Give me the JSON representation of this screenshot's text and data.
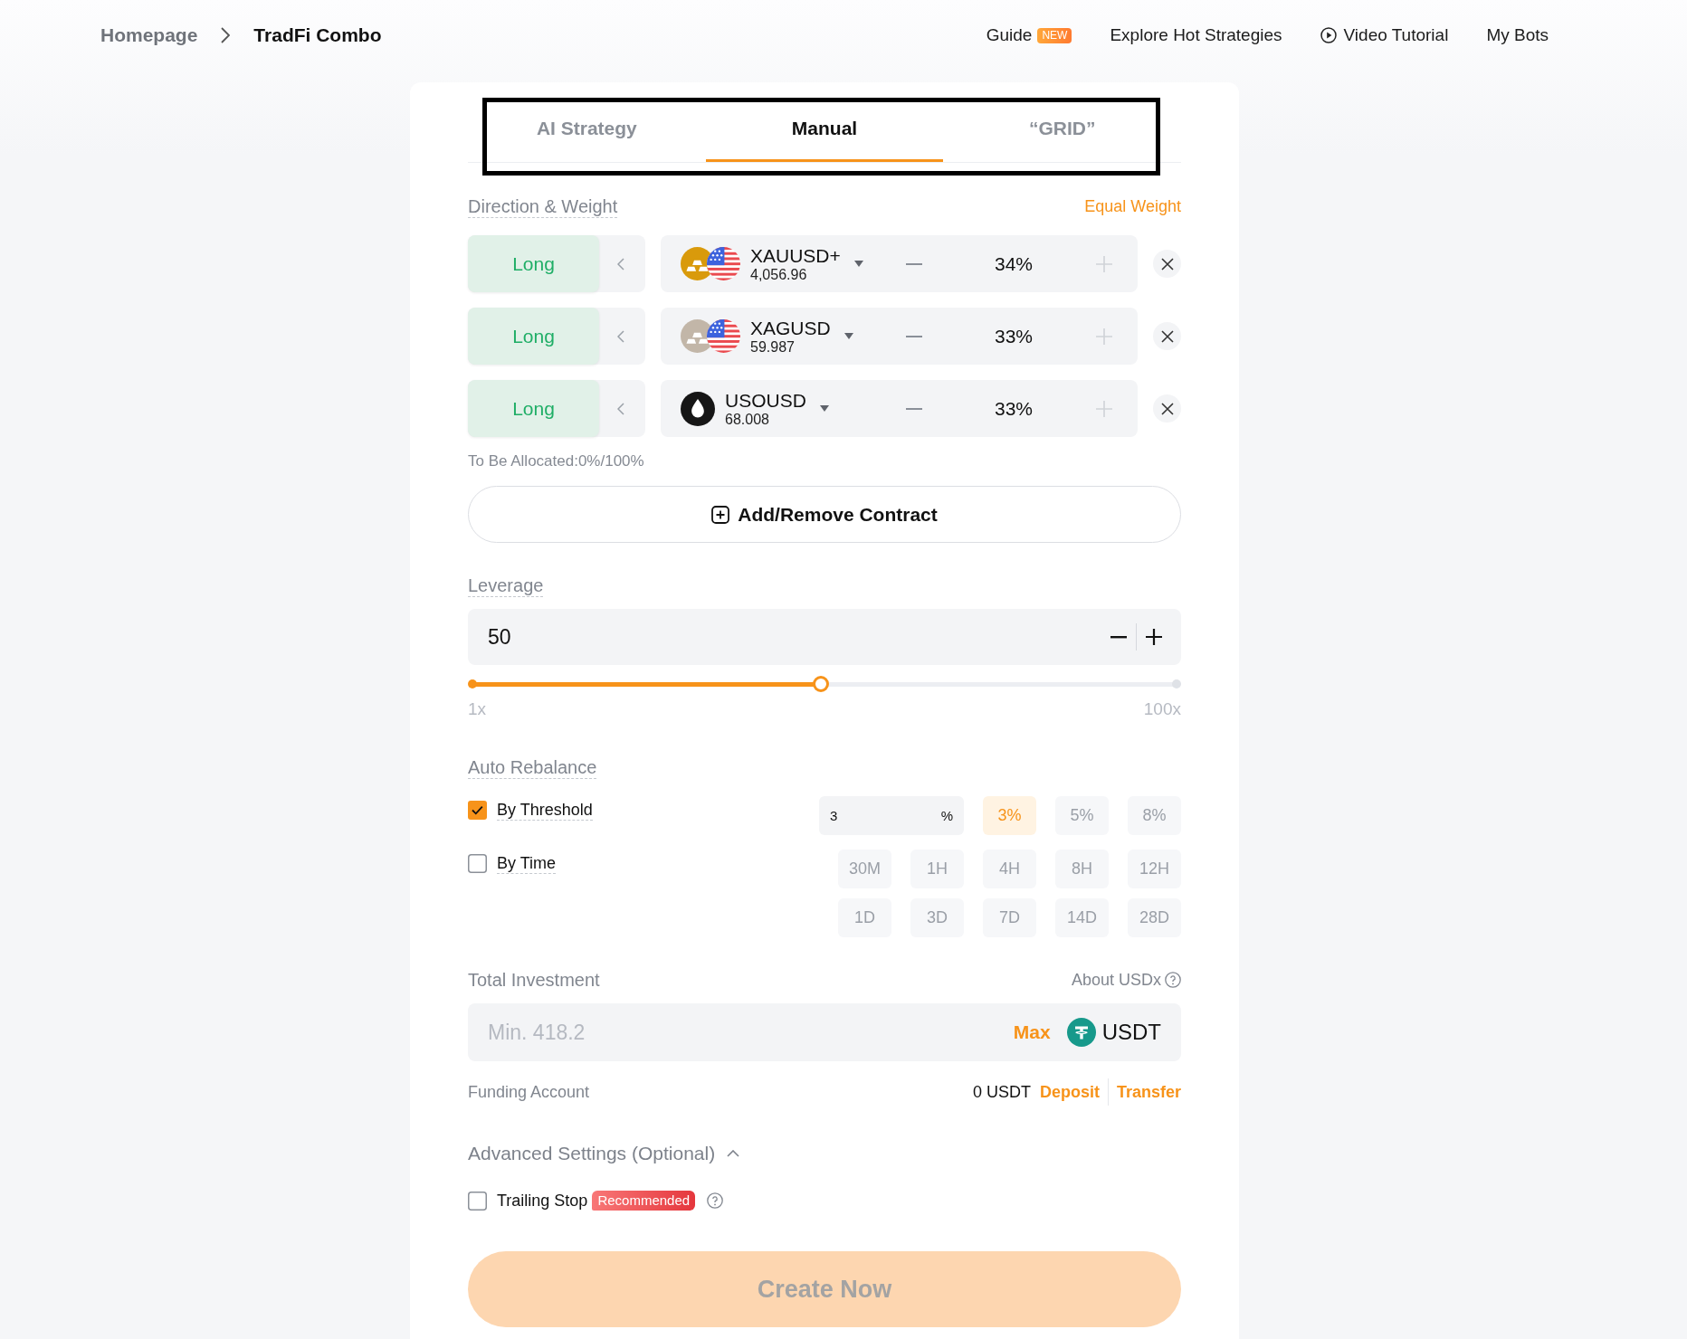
{
  "header": {
    "breadcrumb": [
      {
        "label": "Homepage",
        "current": false
      },
      {
        "label": "TradFi Combo",
        "current": true
      }
    ],
    "nav": [
      {
        "kind": "badge",
        "label": "Guide",
        "badge": "NEW"
      },
      {
        "kind": "plain",
        "label": "Explore Hot Strategies"
      },
      {
        "kind": "video",
        "label": "Video Tutorial"
      },
      {
        "kind": "plain",
        "label": "My Bots"
      }
    ]
  },
  "tab_bar": {
    "outlined": true,
    "tabs": [
      {
        "label": "AI Strategy",
        "selected": false
      },
      {
        "label": "Manual",
        "selected": true
      },
      {
        "label": "“GRID”",
        "selected": false
      }
    ]
  },
  "direction_weight": {
    "label": "Direction & Weight",
    "action": "Equal Weight",
    "rows": [
      {
        "direction": "Long",
        "kind": "gold",
        "symbol": "XAUUSD+",
        "price": "4,056.96",
        "weight": "34%"
      },
      {
        "direction": "Long",
        "kind": "silver",
        "symbol": "XAGUSD",
        "price": "59.987",
        "weight": "33%"
      },
      {
        "direction": "Long",
        "kind": "oil",
        "symbol": "USOUSD",
        "price": "68.008",
        "weight": "33%"
      }
    ]
  },
  "allocation": "To Be Allocated:0%/100%",
  "add_remove": "Add/Remove Contract",
  "leverage": {
    "label": "Leverage",
    "value": "50",
    "level": 0.495,
    "min_label": "1x",
    "max_label": "100x"
  },
  "auto_rebalance": {
    "label": "Auto Rebalance",
    "threshold": {
      "label": "By Threshold",
      "checked": true,
      "value": "3",
      "unit": "%",
      "chips": [
        {
          "label": "3%",
          "selected": true
        },
        {
          "label": "5%",
          "selected": false
        },
        {
          "label": "8%",
          "selected": false
        }
      ]
    },
    "time": {
      "label": "By Time",
      "checked": false,
      "chips": [
        {
          "label": "30M",
          "selected": false
        },
        {
          "label": "1H",
          "selected": false
        },
        {
          "label": "4H",
          "selected": false
        },
        {
          "label": "8H",
          "selected": false
        },
        {
          "label": "12H",
          "selected": false
        },
        {
          "label": "1D",
          "selected": false
        },
        {
          "label": "3D",
          "selected": false
        },
        {
          "label": "7D",
          "selected": false
        },
        {
          "label": "14D",
          "selected": false
        },
        {
          "label": "28D",
          "selected": false
        }
      ]
    }
  },
  "investment": {
    "label": "Total Investment",
    "help": "About USDx",
    "placeholder": "Min. 418.2",
    "max": "Max",
    "currency": "USDT"
  },
  "funding": {
    "label": "Funding Account",
    "balance": "0 USDT",
    "links": [
      "Deposit",
      "Transfer"
    ]
  },
  "advanced": {
    "label": "Advanced Settings (Optional)",
    "expanded": true,
    "options": [
      {
        "label": "Trailing Stop",
        "checked": false,
        "badge": "Recommended"
      }
    ]
  },
  "submit": {
    "label": "Create Now",
    "disabled": true
  }
}
